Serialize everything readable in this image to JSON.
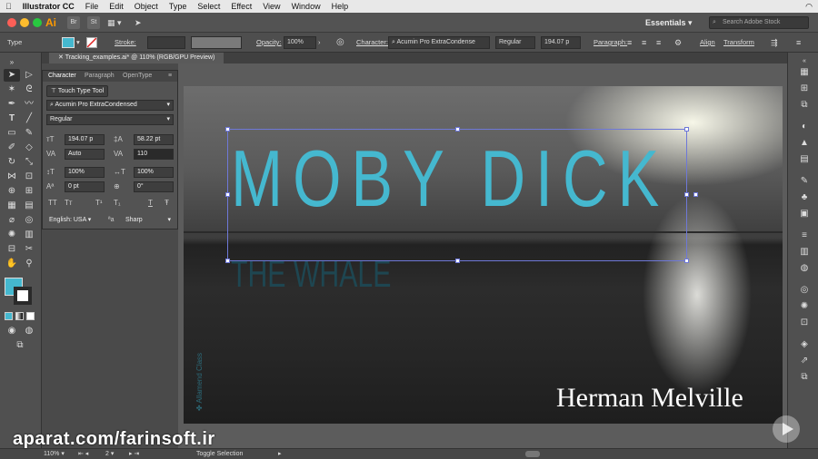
{
  "menubar": {
    "app": "Illustrator CC",
    "items": [
      "File",
      "Edit",
      "Object",
      "Type",
      "Select",
      "Effect",
      "View",
      "Window",
      "Help"
    ]
  },
  "appbar": {
    "logo": "Ai",
    "br": "Br",
    "st": "St",
    "workspace": "Essentials",
    "stock_placeholder": "Search Adobe Stock"
  },
  "control": {
    "type_label": "Type",
    "stroke_label": "Stroke:",
    "opacity_label": "Opacity:",
    "opacity_value": "100%",
    "character_label": "Character:",
    "font": "Acumin Pro ExtraCondense",
    "style": "Regular",
    "size": "194.07 p",
    "paragraph_label": "Paragraph:",
    "align_label": "Align",
    "transform_label": "Transform"
  },
  "doc": {
    "tab_title": "Tracking_examples.ai* @ 110% (RGB/GPU Preview)"
  },
  "character_panel": {
    "tabs": [
      "Character",
      "Paragraph",
      "OpenType"
    ],
    "touch_tool": "Touch Type Tool",
    "font": "Acumin Pro ExtraCondensed",
    "style": "Regular",
    "size": "194.07 p",
    "leading": "58.22 pt",
    "kerning": "Auto",
    "tracking": "110",
    "vscale": "100%",
    "hscale": "100%",
    "baseline": "0 pt",
    "rotation": "0°",
    "language": "English: USA",
    "aa_label": "ªa",
    "antialias": "Sharp",
    "tt_buttons": [
      "TT",
      "Tт",
      "T¹",
      "T₁",
      "T",
      "Ŧ"
    ]
  },
  "artwork": {
    "title": "MOBY DICK",
    "subtitle": "THE WHALE",
    "author": "Herman Melville",
    "logo_text": "Allamend Classics",
    "title_color": "#45b8cf",
    "subtitle_color": "#1d4a56"
  },
  "status": {
    "zoom": "110%",
    "page": "2",
    "toggle": "Toggle Selection"
  },
  "watermark": "aparat.com/farinsoft.ir",
  "colors": {
    "fill": "#45b8cf"
  }
}
